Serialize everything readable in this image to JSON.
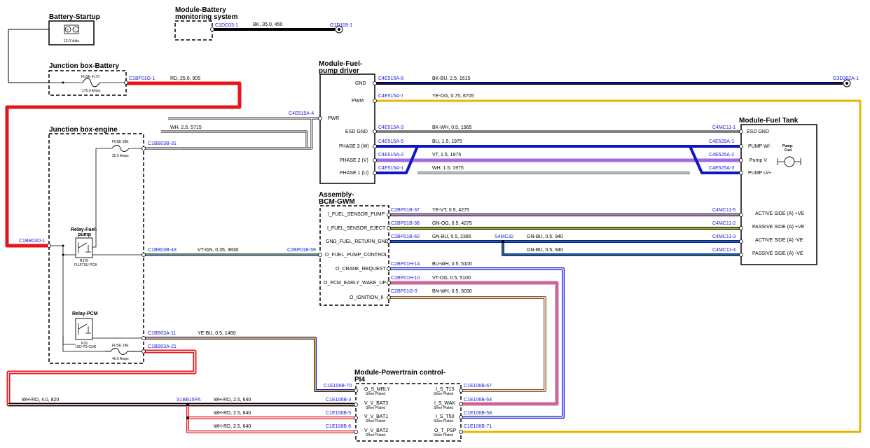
{
  "colors": {
    "red": "#e8141c",
    "black": "#000000",
    "blue": "#0d17c8",
    "violet": "#a36be0",
    "yellow": "#f2c200",
    "pink": "#d66aa0",
    "brown": "#8a5a2b",
    "green": "#2b8a2b",
    "olive": "#9bb51a",
    "grey": "#888888",
    "label_blue": "#1a1adc"
  },
  "icons": [
    "battery-icon",
    "fuse-icon",
    "relay-icon",
    "ground-icon",
    "pump-icon"
  ],
  "components": {
    "battery": {
      "title": "Battery-Startup",
      "sub": "12.0 Volts"
    },
    "bms": {
      "title_1": "Module-Battery",
      "title_2": "monitoring system"
    },
    "jb_battery": {
      "title": "Junction box-Battery",
      "fuse": "FUSE FL70",
      "amps": "175.0 Amps"
    },
    "fuel_driver": {
      "title_1": "Module-Fuel-",
      "title_2": "pump driver",
      "pins": [
        "GND",
        "PWM",
        "PWR",
        "ESD GND",
        "PHASE 3 (W)",
        "PHASE 2 (V)",
        "PHASE 1 (U)"
      ]
    },
    "fuel_tank": {
      "title": "Module-Fuel Tank",
      "pins": [
        "ESD GND",
        "PUMP W/-",
        "Pump V",
        "PUMP U/+",
        "ACTIVE SIDE (A) +VE",
        "PASSIVE SIDE (A) +VE",
        "ACTIVE SIDE (A) -VE",
        "PASSIVE SIDE (A) -VE"
      ],
      "pump_1": "Pump-",
      "pump_2": "Fuel"
    },
    "jb_engine": {
      "title": "Junction box-engine",
      "fuse28": "FUSE 28E",
      "amps28": "25.0 Amps",
      "relay_fuel_1": "Relay-Fuel-",
      "relay_fuel_2": "pump",
      "relay_fuel_sub_1": "R176",
      "relay_fuel_sub_2": "FUJITSU PCB",
      "relay_pcm": "Relay-PCM",
      "relay_pcm_sub_1": "R16",
      "relay_pcm_sub_2": "ISO PS-CUR",
      "fuse19": "FUSE 19E",
      "amps19": "40.0 Amps"
    },
    "bcm": {
      "title_1": "Assembly-",
      "title_2": "BCM-GWM",
      "pins": [
        "I_FUEL_SENSOR_PUMP",
        "I_FUEL_SENSOR_EJECT",
        "GND_FUEL_RETURN_GND",
        "O_FUEL_PUMP_CONTROL",
        "O_CRANK_REQUEST",
        "O_PCM_EARLY_WAKE_UP",
        "O_IGNITION_6"
      ]
    },
    "pcm": {
      "title_1": "Module-Powertrain control-",
      "title_2": "PI4",
      "left_pins": [
        "O_S_MRLY",
        "V_V_BAT3",
        "V_V_BAT1",
        "V_V_BAT2"
      ],
      "right_pins": [
        "I_S_T15",
        "I_S_WAK",
        "I_S_T50",
        "O_T_PSP"
      ],
      "plated": "Silver Plated"
    }
  },
  "connectors": {
    "c1": "C1DC03-1",
    "c2": "G1D108-1",
    "c3": "C1BF01G-1",
    "c4": "C4E515A-8",
    "c5": "G3D362A-1",
    "c6": "C4E515A-7",
    "c7": "C4E515A-4",
    "c8": "C4E515A-3",
    "c9": "C4MC11-1",
    "c10": "C4E515A-5",
    "c11": "C4E525A-1",
    "c12": "C4E515A-2",
    "c13": "C4E525A-2",
    "c14": "C4E515A-1",
    "c15": "C4E525A-3",
    "c16": "C1BB03B-31",
    "c17": "C1BB03D-1",
    "c18": "C2BP01B-37",
    "c19": "C4MC11-5",
    "c20": "C2BP01B-38",
    "c21": "C4MC11-2",
    "c22": "C2BP01B-60",
    "c23": "S4MC32",
    "c24": "C4MC11-3",
    "c25": "C4MC11-4",
    "c26": "C1BB03B-43",
    "c27": "C2BP01B-59",
    "c28": "C2BP01H-14",
    "c29": "C2BP01H-10",
    "c30": "C2BP01G-9",
    "c31": "C1BB03A-11",
    "c32": "C1BB03A-21",
    "c33": "C1E106B-70",
    "c34": "C1E106B-67",
    "c35": "S1BB15PA",
    "c36": "C1E106B-3",
    "c37": "C1E106B-64",
    "c38": "C1E106B-5",
    "c39": "C1E106B-58",
    "c40": "C1E106B-6",
    "c41": "C1E106B-71"
  },
  "wires": {
    "w1": "BK, 35.0, 450",
    "w2": "RD, 25.0, 905",
    "w3": "BK-BU, 2.5, 1615",
    "w4": "YE-OG, 0.75, 6705",
    "w5": "WH, 2.5, 5715",
    "w6": "BK-WH, 0.5, 1965",
    "w7": "BU, 1.5, 1975",
    "w8": "VT, 1.5, 1975",
    "w9": "WH, 1.5, 1975",
    "w10": "YE-VT, 0.5, 4275",
    "w11": "GN-OG, 0.5, 4275",
    "w12": "GN-BU, 0.5, 2385",
    "w13": "GN-BU, 0.5, 940",
    "w14": "GN-BU, 0.5, 940",
    "w15": "VT-GN, 0.35, 3830",
    "w16": "BU-WH, 0.5, 5100",
    "w17": "VT-OG, 0.5, 5100",
    "w18": "BN-WH, 0.5, 5030",
    "w19": "YE-BU, 0.5, 1460",
    "w20": "WH-RD, 4.0, 820",
    "w21": "WH-RD, 2.5, 640",
    "w22": "WH-RD, 2.5, 640",
    "w23": "WH-RD, 2.5, 640"
  }
}
